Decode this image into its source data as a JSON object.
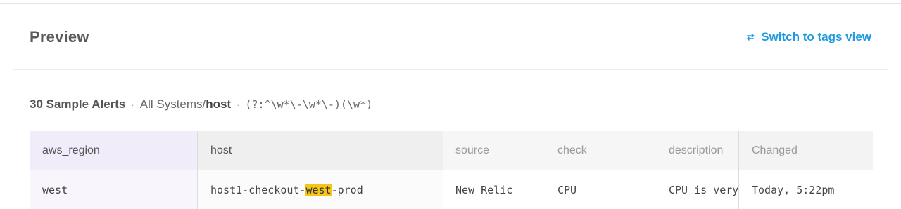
{
  "header": {
    "title": "Preview",
    "switch_label": "Switch to tags view",
    "switch_icon": "swap-icon"
  },
  "summary": {
    "count_label": "30 Sample Alerts",
    "separator": "·",
    "system_prefix": "All Systems/",
    "system_field": "host",
    "regex": "(?:^\\w*\\-\\w*\\-)(\\w*)"
  },
  "table": {
    "columns": [
      "aws_region",
      "host",
      "source",
      "check",
      "description",
      "Changed"
    ],
    "rows": [
      {
        "aws_region": "west",
        "host_prefix": "host1-checkout-",
        "host_match": "west",
        "host_suffix": "-prod",
        "source": "New Relic",
        "check": "CPU",
        "description": "CPU is very high",
        "changed": "Today, 5:22pm"
      }
    ]
  },
  "colors": {
    "accent": "#1e9be0",
    "highlight": "#f5c518",
    "extracted_column_bg": "#f1ecf9"
  }
}
